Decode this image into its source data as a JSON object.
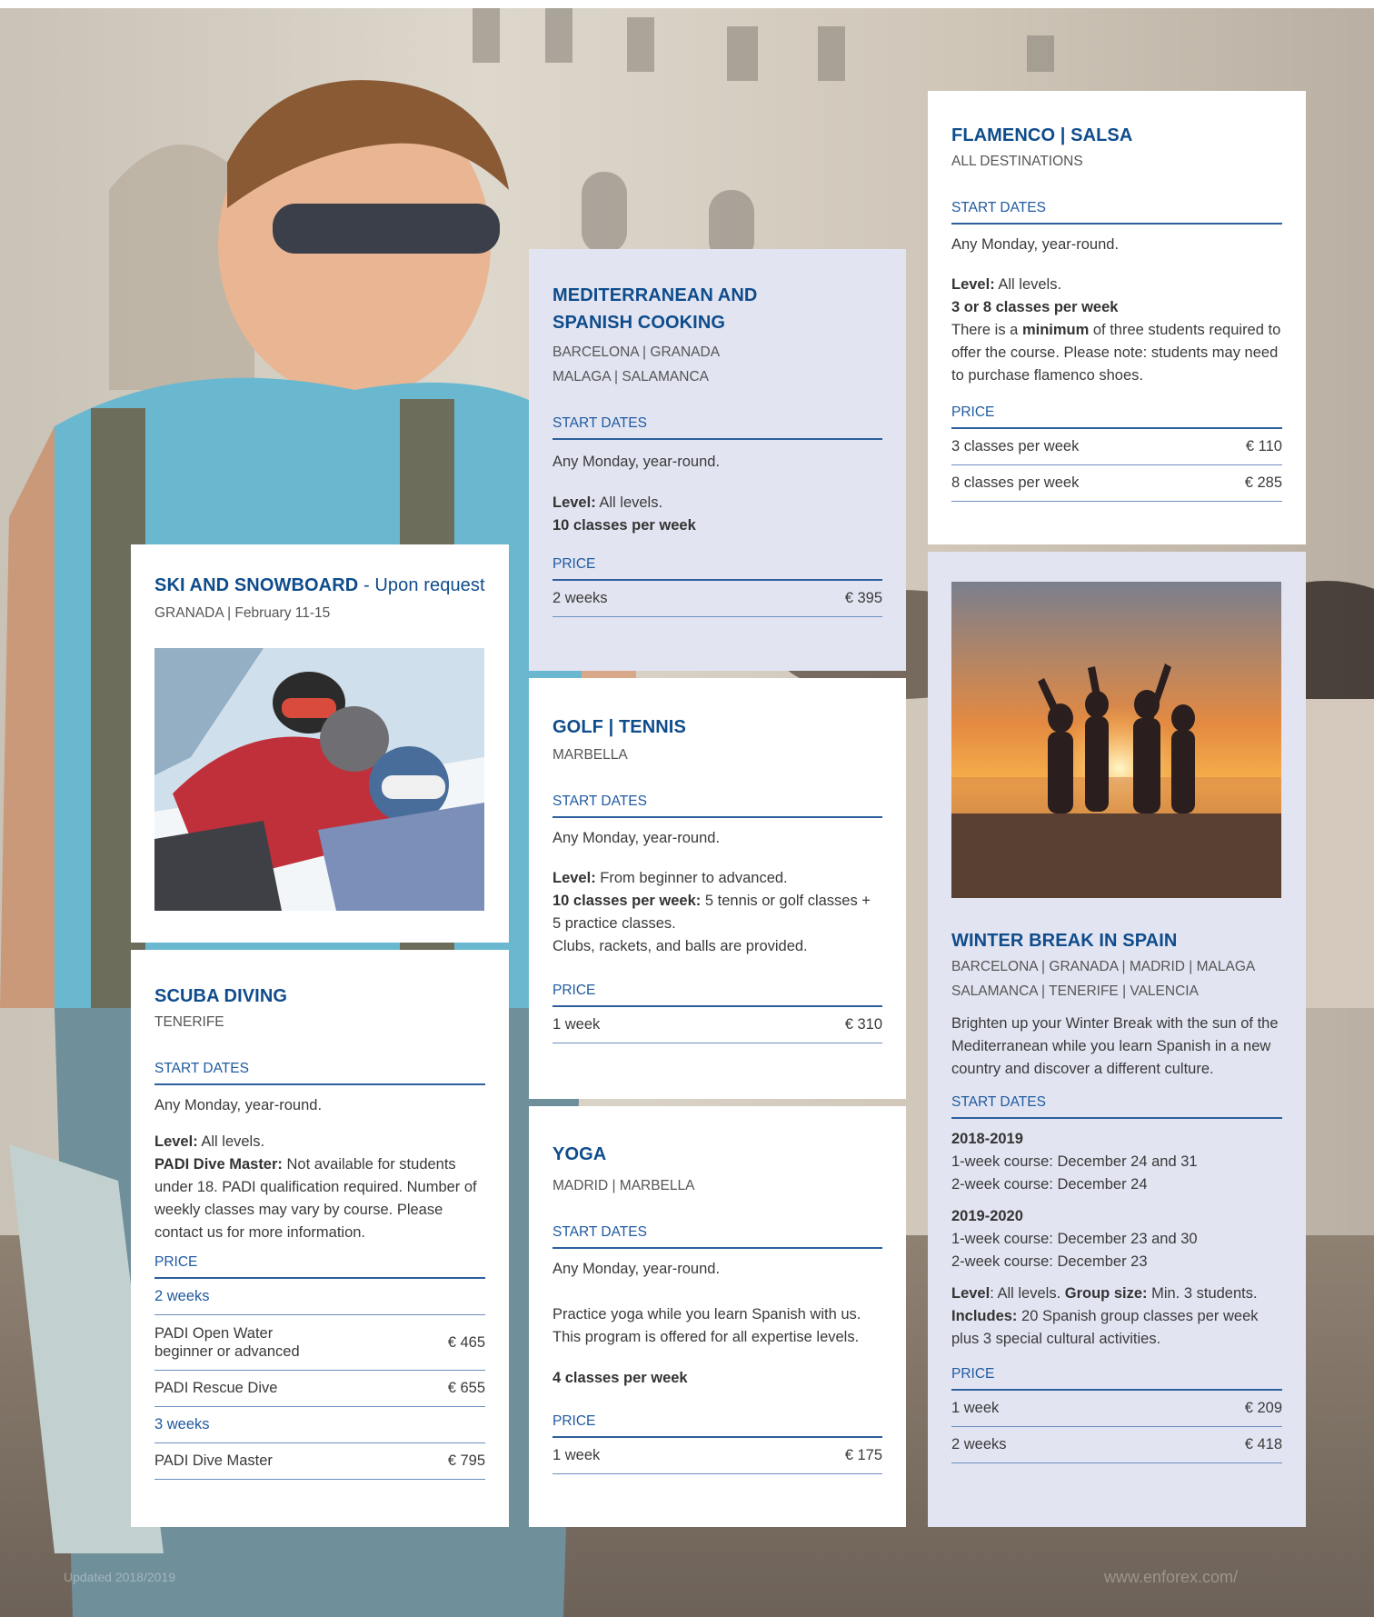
{
  "ski": {
    "title": "SKI AND SNOWBOARD",
    "title_suffix": "- Upon request",
    "destinations": "GRANADA  |  February 11-15"
  },
  "cooking": {
    "title_line1": "MEDITERRANEAN AND",
    "title_line2": "SPANISH COOKING",
    "dest_line1": "BARCELONA  |  GRANADA",
    "dest_line2": "MALAGA  |  SALAMANCA",
    "start_dates_label": "START DATES",
    "start_dates": "Any Monday, year-round.",
    "level_label": "Level:",
    "level_value": " All levels.",
    "classes": "10 classes per week",
    "price_label": "PRICE",
    "prices": [
      {
        "label": "2 weeks",
        "price": "€ 395"
      }
    ]
  },
  "flamenco": {
    "title": "FLAMENCO | SALSA",
    "destinations": "ALL DESTINATIONS",
    "start_dates_label": "START DATES",
    "start_dates": "Any Monday, year-round.",
    "level_label": "Level:",
    "level_value": " All levels.",
    "classes": "3 or 8 classes per week",
    "note_pre": "There is a ",
    "note_bold": "minimum",
    "note_post": " of three students required to offer the course. Please note: students may need to purchase flamenco shoes.",
    "price_label": "PRICE",
    "prices": [
      {
        "label": "3 classes per week",
        "price": "€ 110"
      },
      {
        "label": "8 classes per week",
        "price": "€ 285"
      }
    ]
  },
  "golf": {
    "title": "GOLF | TENNIS",
    "destinations": "MARBELLA",
    "start_dates_label": "START DATES",
    "start_dates": "Any Monday, year-round.",
    "level_label": "Level:",
    "level_value": " From beginner to advanced.",
    "classes_label": "10 classes per week:",
    "classes_value": " 5 tennis or golf classes + 5 practice classes.",
    "equipment": "Clubs, rackets, and balls are provided.",
    "price_label": "PRICE",
    "prices": [
      {
        "label": "1 week",
        "price": "€ 310"
      }
    ]
  },
  "scuba": {
    "title": "SCUBA DIVING",
    "destinations": "TENERIFE",
    "start_dates_label": "START DATES",
    "start_dates": "Any Monday, year-round.",
    "level_label": "Level:",
    "level_value": " All levels.",
    "padi_label": "PADI Dive Master:",
    "padi_value": " Not available for students under 18. PADI qualification required. Number of weekly classes may vary by course. Please contact us for more information.",
    "price_label": "PRICE",
    "group1": "2 weeks",
    "open_water_line1": "PADI Open Water",
    "open_water_line2": "beginner or advanced",
    "open_water_price": "€ 465",
    "rescue_label": "PADI Rescue Dive",
    "rescue_price": "€ 655",
    "group2": "3 weeks",
    "master_label": "PADI Dive Master",
    "master_price": "€ 795"
  },
  "yoga": {
    "title": "YOGA",
    "destinations": "MADRID | MARBELLA",
    "start_dates_label": "START DATES",
    "start_dates": "Any Monday, year-round.",
    "description": "Practice yoga while you learn Spanish with us. This program is offered for all expertise levels.",
    "classes": "4 classes per week",
    "price_label": "PRICE",
    "prices": [
      {
        "label": "1 week",
        "price": "€ 175"
      }
    ]
  },
  "winter": {
    "title": "WINTER BREAK IN SPAIN",
    "dest_line1": "BARCELONA | GRANADA | MADRID | MALAGA",
    "dest_line2": "SALAMANCA | TENERIFE | VALENCIA",
    "description": "Brighten up your Winter Break with the sun of the Mediterranean while you learn Spanish in a new country and discover a different culture.",
    "start_dates_label": "START DATES",
    "year1": "2018-2019",
    "year1_line1": "1-week course: December 24 and 31",
    "year1_line2": "2-week course: December 24",
    "year2": "2019-2020",
    "year2_line1": "1-week course: December 23 and 30",
    "year2_line2": "2-week course: December 23",
    "level_label": "Level",
    "level_value": ": All levels. ",
    "group_label": "Group size:",
    "group_value": " Min. 3 students.",
    "includes_label": "Includes:",
    "includes_value": " 20 Spanish group classes per week plus 3 special cultural activities.",
    "price_label": "PRICE",
    "prices": [
      {
        "label": "1 week",
        "price": "€ 209"
      },
      {
        "label": "2 weeks",
        "price": "€ 418"
      }
    ]
  },
  "footer": {
    "left": "Updated 2018/2019",
    "right": "www.enforex.com/"
  }
}
